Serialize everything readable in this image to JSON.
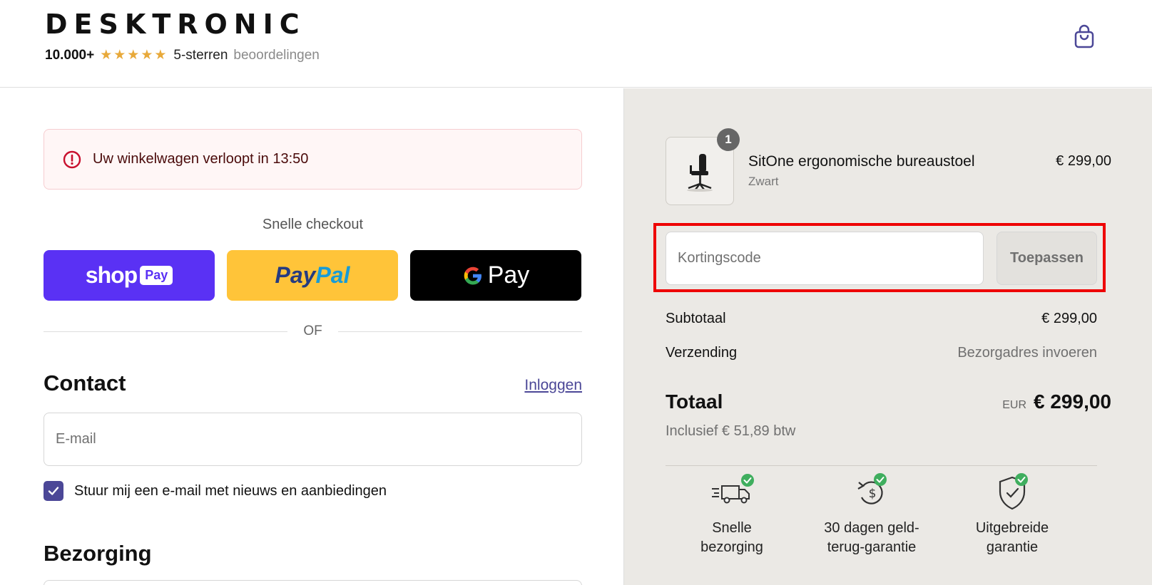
{
  "header": {
    "logo_text": "DESKTRONIC",
    "rating_count": "10.000+",
    "rating_stars": "★★★★★",
    "rating_label_main": "5-sterren",
    "rating_label_sub": "beoordelingen",
    "cart_icon": "shopping-bag-icon"
  },
  "checkout": {
    "timer_message": "Uw winkelwagen verloopt in 13:50",
    "quick_checkout_title": "Snelle checkout",
    "shop_pay_word": "shop",
    "shop_pay_pill": "Pay",
    "paypal_part1": "Pay",
    "paypal_part2": "Pal",
    "gpay_word": "Pay",
    "or_text": "OF"
  },
  "contact": {
    "title": "Contact",
    "login_link": "Inloggen",
    "email_placeholder": "E-mail",
    "newsletter_label": "Stuur mij een e-mail met nieuws en aanbiedingen",
    "newsletter_checked": true
  },
  "delivery": {
    "title": "Bezorging"
  },
  "order_summary": {
    "product": {
      "name": "SitOne ergonomische bureaustoel",
      "variant": "Zwart",
      "price": "€ 299,00",
      "quantity": "1"
    },
    "discount_placeholder": "Kortingscode",
    "apply_label": "Toepassen",
    "subtotal_label": "Subtotaal",
    "subtotal_value": "€ 299,00",
    "shipping_label": "Verzending",
    "shipping_value": "Bezorgadres invoeren",
    "total_label": "Totaal",
    "total_currency": "EUR",
    "total_value": "€ 299,00",
    "tax_line": "Inclusief € 51,89 btw"
  },
  "benefits": [
    {
      "line1": "Snelle",
      "line2": "bezorging",
      "icon": "fast-delivery-truck-icon"
    },
    {
      "line1": "30 dagen geld-",
      "line2": "terug-garantie",
      "icon": "money-back-icon"
    },
    {
      "line1": "Uitgebreide",
      "line2": "garantie",
      "icon": "shield-check-icon"
    }
  ],
  "colors": {
    "accent": "#4b4797",
    "shop_pay": "#5a31f4",
    "paypal": "#ffc439",
    "highlight": "#ee0000",
    "summary_bg": "#ebe9e5"
  }
}
